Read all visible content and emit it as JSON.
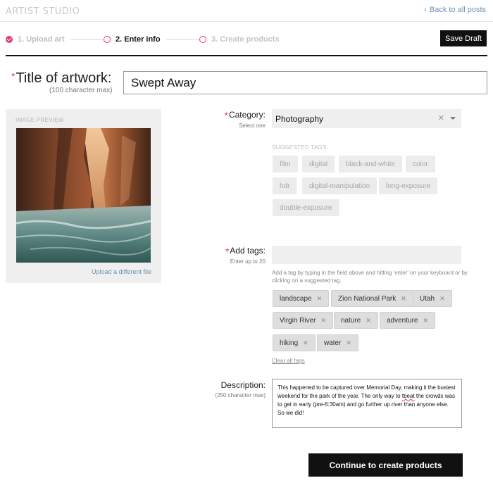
{
  "header": {
    "brand": "ARTIST STUDIO",
    "back_link": "Back to all posts"
  },
  "steps": [
    {
      "label": "1. Upload art",
      "state": "done"
    },
    {
      "label": "2. Enter info",
      "state": "active"
    },
    {
      "label": "3. Create products",
      "state": "todo"
    }
  ],
  "save_draft_label": "Save Draft",
  "title_field": {
    "label": "Title of artwork:",
    "hint": "(100 character max)",
    "value": "Swept Away"
  },
  "preview": {
    "label": "IMAGE PREVIEW",
    "upload_link": "Upload a different file"
  },
  "category": {
    "label": "Category:",
    "hint": "Select one",
    "value": "Photography"
  },
  "suggested": {
    "label": "SUGGESTED TAGS:",
    "chips": [
      "film",
      "digital",
      "black-and-white",
      "color",
      "hdr",
      "digital-manipulation",
      "long-exposure",
      "double-exposure"
    ]
  },
  "tags": {
    "label": "Add tags:",
    "hint": "Enter up to 20",
    "help": "Add a tag by typing in the field above and hitting 'enter' on your keyboard or by clicking on a suggested tag.",
    "items": [
      "landscape",
      "Zion National Park",
      "Utah",
      "Virgin River",
      "nature",
      "adventure",
      "hiking",
      "water"
    ],
    "clear_all": "Clear all tags"
  },
  "description": {
    "label": "Description:",
    "hint": "(250 character max)",
    "text_before": "This happened to be captured over Memorial Day, making it the busiest weekend for the park of the year. The only way to ",
    "misspelled": "tbeat",
    "text_after": " the crowds was to get in early (pre-6:30am) and go further up river than anyone else. So we did!"
  },
  "continue_label": "Continue to create products",
  "colors": {
    "accent": "#e23c6e",
    "link": "#6e93b3",
    "button": "#111111"
  }
}
